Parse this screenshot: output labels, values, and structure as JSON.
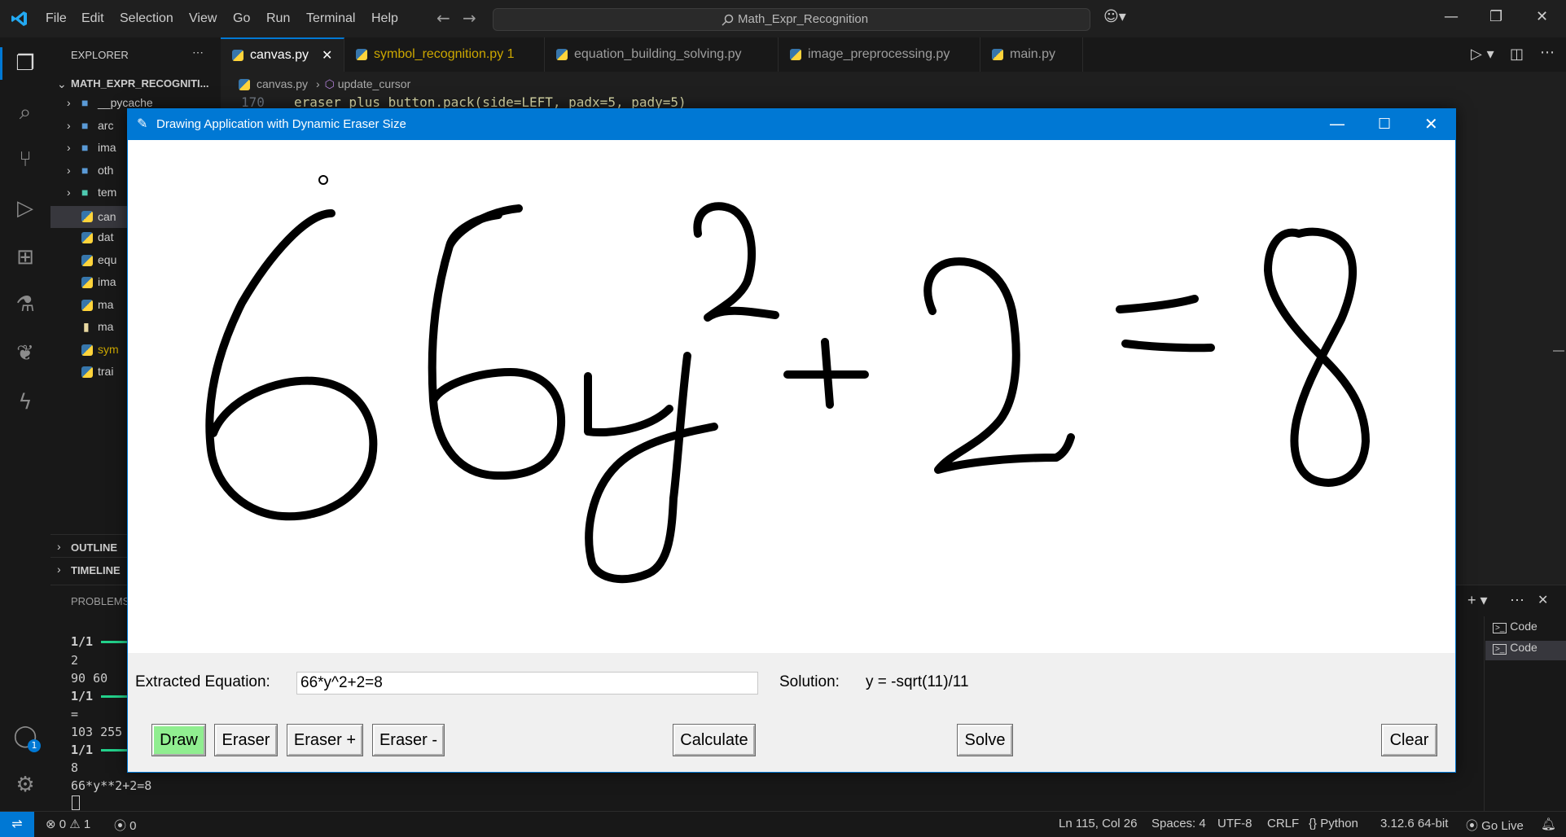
{
  "menu": [
    "File",
    "Edit",
    "Selection",
    "View",
    "Go",
    "Run",
    "Terminal",
    "Help"
  ],
  "search": {
    "text": "Math_Expr_Recognition"
  },
  "explorer": {
    "title": "EXPLORER",
    "root": "MATH_EXPR_RECOGNITI...",
    "items": [
      {
        "label": "__pycache_",
        "type": "folder"
      },
      {
        "label": "arc",
        "type": "folder"
      },
      {
        "label": "ima",
        "type": "folder"
      },
      {
        "label": "oth",
        "type": "folder"
      },
      {
        "label": "tem",
        "type": "folder"
      },
      {
        "label": "can",
        "type": "py"
      },
      {
        "label": "dat",
        "type": "py"
      },
      {
        "label": "equ",
        "type": "py"
      },
      {
        "label": "ima",
        "type": "py"
      },
      {
        "label": "ma",
        "type": "py"
      },
      {
        "label": "ma",
        "type": "file"
      },
      {
        "label": "sym",
        "type": "py"
      },
      {
        "label": "trai",
        "type": "py"
      }
    ],
    "outline": "OUTLINE",
    "timeline": "TIMELINE"
  },
  "tabs": [
    {
      "label": "canvas.py",
      "active": true
    },
    {
      "label": "symbol_recognition.py 1",
      "warn": true
    },
    {
      "label": "equation_building_solving.py"
    },
    {
      "label": "image_preprocessing.py"
    },
    {
      "label": "main.py"
    }
  ],
  "breadcrumb": {
    "file": "canvas.py",
    "symbol": "update_cursor"
  },
  "code_line": {
    "num": "170",
    "text": "eraser_plus_button.pack(side=LEFT, padx=5, pady=5)"
  },
  "panel": {
    "tab": "PROBLEMS",
    "terminal_lines": [
      "1/1",
      "2",
      "90 60",
      "1/1",
      "=",
      "103 255",
      "1/1",
      "8",
      "66*y**2+2=8"
    ],
    "terminals": [
      "Code",
      "Code"
    ]
  },
  "status": {
    "errors": "0",
    "warnings": "1",
    "ports": "0",
    "position": "Ln 115, Col 26",
    "spaces": "Spaces: 4",
    "encoding": "UTF-8",
    "eol": "CRLF",
    "language": "Python",
    "interpreter": "3.12.6 64-bit",
    "golive": "Go Live"
  },
  "accounts_badge": "1",
  "app": {
    "title": "Drawing Application with Dynamic Eraser Size",
    "extracted_label": "Extracted Equation:",
    "extracted_value": "66*y^2+2=8",
    "solution_label": "Solution:",
    "solution_value": "y = -sqrt(11)/11",
    "buttons": {
      "draw": "Draw",
      "eraser": "Eraser",
      "eraser_plus": "Eraser +",
      "eraser_minus": "Eraser -",
      "calculate": "Calculate",
      "solve": "Solve",
      "clear": "Clear"
    }
  },
  "colors": {
    "accent": "#0078d4",
    "draw_active": "#90ee90",
    "warn_tab": "#cca700"
  }
}
